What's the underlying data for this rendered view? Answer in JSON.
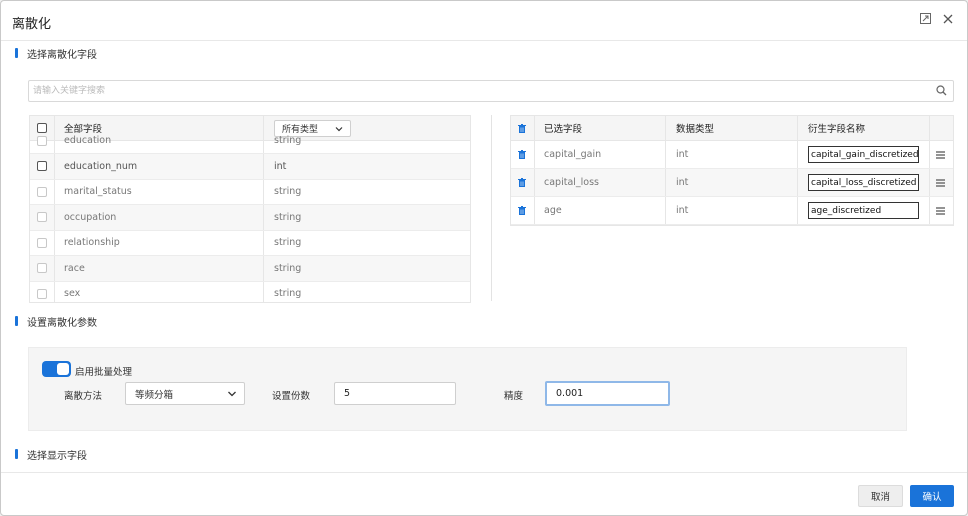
{
  "dialog": {
    "title": "离散化",
    "icons": {
      "maximize": "expand-icon",
      "close": "close-icon"
    }
  },
  "sections": {
    "select_fields": "选择离散化字段",
    "params": "设置离散化参数",
    "display_fields": "选择显示字段"
  },
  "search": {
    "placeholder": "请输入关键字搜索",
    "value": ""
  },
  "left_table": {
    "header": {
      "field": "全部字段",
      "type_filter": "所有类型"
    },
    "rows": [
      {
        "field": "education",
        "type": "string",
        "enabled": false
      },
      {
        "field": "education_num",
        "type": "int",
        "enabled": true
      },
      {
        "field": "marital_status",
        "type": "string",
        "enabled": false
      },
      {
        "field": "occupation",
        "type": "string",
        "enabled": false
      },
      {
        "field": "relationship",
        "type": "string",
        "enabled": false
      },
      {
        "field": "race",
        "type": "string",
        "enabled": false
      },
      {
        "field": "sex",
        "type": "string",
        "enabled": false
      }
    ]
  },
  "right_table": {
    "header": {
      "selected": "已选字段",
      "type": "数据类型",
      "derived": "衍生字段名称"
    },
    "rows": [
      {
        "field": "capital_gain",
        "type": "int",
        "derived": "capital_gain_discretized"
      },
      {
        "field": "capital_loss",
        "type": "int",
        "derived": "capital_loss_discretized"
      },
      {
        "field": "age",
        "type": "int",
        "derived": "age_discretized"
      }
    ]
  },
  "params": {
    "batch_toggle": {
      "label": "启用批量处理",
      "on": true
    },
    "method": {
      "label": "离散方法",
      "value": "等频分箱"
    },
    "bins": {
      "label": "设置份数",
      "value": "5"
    },
    "precision": {
      "label": "精度",
      "value": "0.001"
    }
  },
  "footer": {
    "cancel": "取消",
    "confirm": "确认"
  },
  "colors": {
    "accent": "#1a73d9"
  }
}
